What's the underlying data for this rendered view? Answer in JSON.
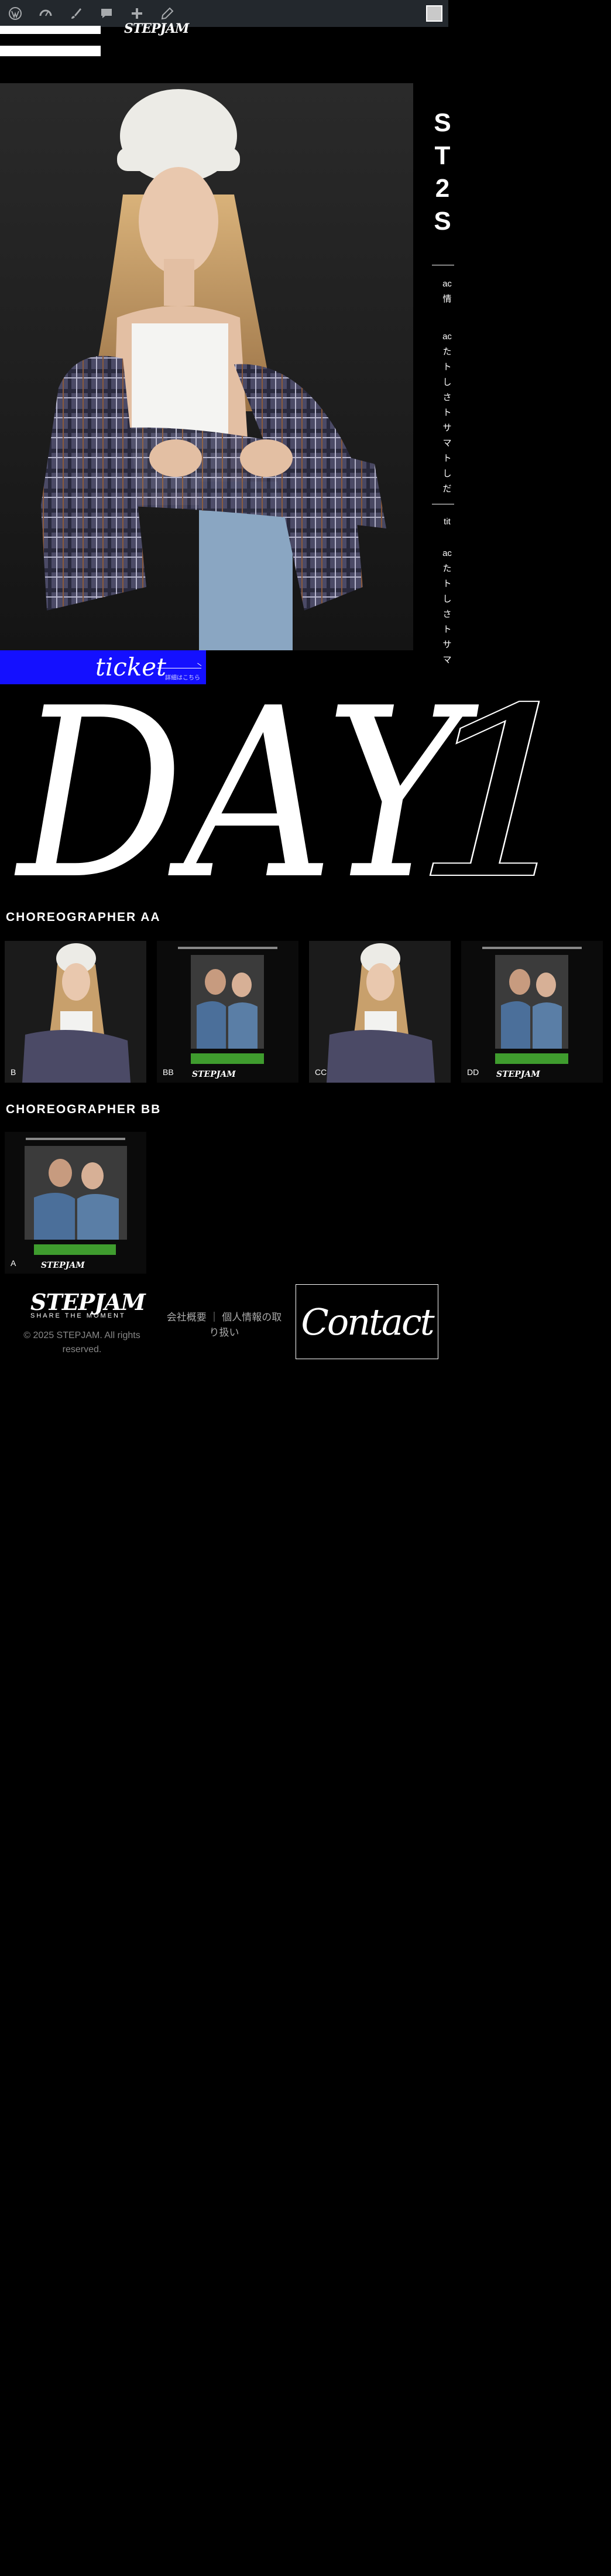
{
  "admin_bar": {
    "icons": [
      "wordpress-icon",
      "dashboard-icon",
      "customize-icon",
      "comments-icon",
      "new-content-icon",
      "edit-icon"
    ],
    "avatar": "user-avatar"
  },
  "site": {
    "logo_small": "STEPJAM"
  },
  "hero": {
    "vertical_title": [
      "S",
      "T",
      "2",
      "S"
    ],
    "vertical_text_1": "ac 情",
    "vertical_text_2": "ac たトしさトサマトしだ",
    "vertical_text_3": "tit",
    "vertical_text_4": "ac たトしさトサマ",
    "ticket": {
      "label": "ticket",
      "sub": "詳細はこちら"
    }
  },
  "day_heading": {
    "word": "DAY",
    "num": "1"
  },
  "sections": [
    {
      "title": "CHOREOGRAPHER AA",
      "cards": [
        {
          "label": "B",
          "kind": "portrait"
        },
        {
          "label": "BB",
          "kind": "poster"
        },
        {
          "label": "CC",
          "kind": "portrait"
        },
        {
          "label": "DD",
          "kind": "poster"
        }
      ]
    },
    {
      "title": "CHOREOGRAPHER BB",
      "cards": [
        {
          "label": "A",
          "kind": "poster"
        }
      ]
    }
  ],
  "footer": {
    "logo": "STEPJAM",
    "logo_sub": "SHARE THE MOMENT",
    "copyright": "© 2025 STEPJAM. All rights reserved.",
    "links": "会社概要 ｜ 個人情報の取り扱い",
    "contact": "Contact"
  },
  "colors": {
    "ticket": "#1410ff",
    "background": "#000000",
    "poster_green": "#3f9c2e"
  }
}
